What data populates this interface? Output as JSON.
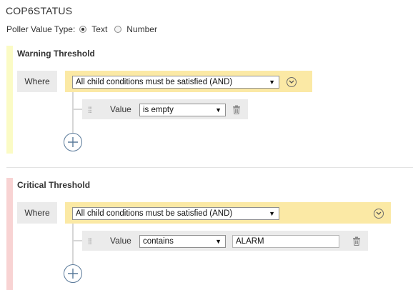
{
  "header": {
    "title": "COP6STATUS"
  },
  "poller": {
    "label": "Poller Value Type:",
    "options": [
      {
        "label": "Text",
        "selected": true
      },
      {
        "label": "Number",
        "selected": false
      }
    ]
  },
  "warning": {
    "title": "Warning Threshold",
    "where_label": "Where",
    "condition_select": "All child conditions must be satisfied (AND)",
    "rows": [
      {
        "field_label": "Value",
        "operator": "is empty",
        "value": ""
      }
    ]
  },
  "critical": {
    "title": "Critical Threshold",
    "where_label": "Where",
    "condition_select": "All child conditions must be satisfied (AND)",
    "rows": [
      {
        "field_label": "Value",
        "operator": "contains",
        "value": "ALARM"
      }
    ]
  },
  "colors": {
    "warning_stripe": "#fbfbc5",
    "critical_stripe": "#f8d3d3",
    "condition_bar": "#fbe9a5",
    "row_background": "#ebebeb"
  },
  "icons": {
    "radio": "radio-icon",
    "dropdown_arrow": "triangle-down",
    "collapse": "chevron-down-circle-icon",
    "drag": "drag-handle-icon",
    "delete": "trash-icon",
    "add": "plus-circle-icon"
  }
}
